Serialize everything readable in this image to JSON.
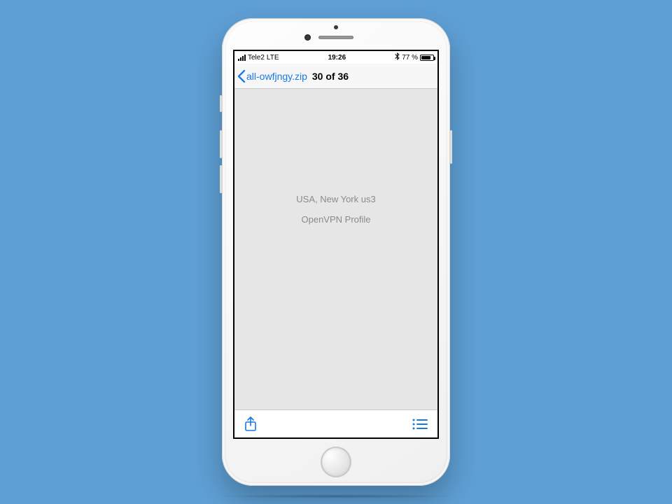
{
  "statusbar": {
    "carrier": "Tele2",
    "network": "LTE",
    "time": "19:26",
    "battery_text": "77 %"
  },
  "navbar": {
    "back_label": "all-owfjngy.zip",
    "title": "30 of 36"
  },
  "content": {
    "line1": "USA, New York us3",
    "line2": "OpenVPN Profile"
  },
  "colors": {
    "ios_blue": "#1978E6",
    "background": "#5E9FD4"
  }
}
